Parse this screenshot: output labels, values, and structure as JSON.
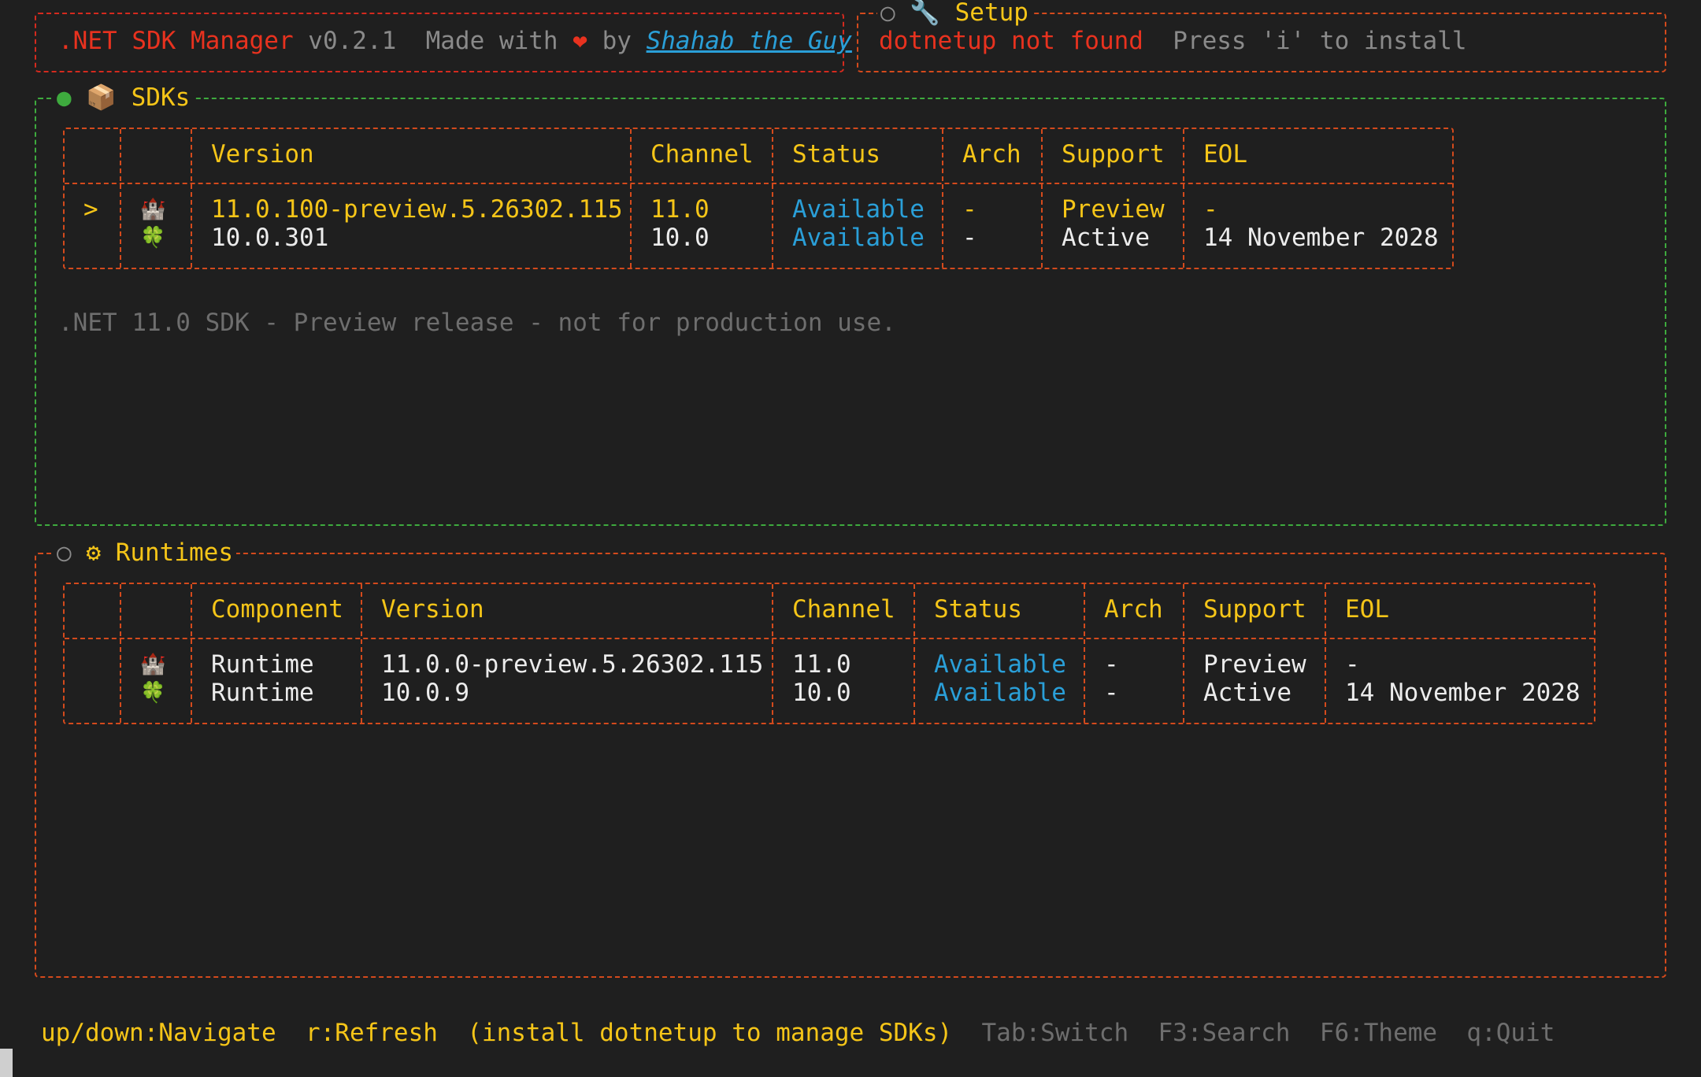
{
  "header": {
    "app_name": ".NET SDK Manager",
    "version": "v0.2.1",
    "made_with": "Made with",
    "by": "by",
    "author": "Shahab the Guy"
  },
  "setup": {
    "title": "Setup",
    "status": "dotnetup not found",
    "hint": "Press 'i' to install"
  },
  "sdks": {
    "title": "SDKs",
    "columns": [
      "Version",
      "Channel",
      "Status",
      "Arch",
      "Support",
      "EOL"
    ],
    "rows": [
      {
        "selector": ">",
        "icon": "castle-icon",
        "version": "11.0.100-preview.5.26302.115",
        "channel": "11.0",
        "status": "Available",
        "arch": "-",
        "support": "Preview",
        "eol": "-"
      },
      {
        "selector": "",
        "icon": "clover-icon",
        "version": "10.0.301",
        "channel": "10.0",
        "status": "Available",
        "arch": "-",
        "support": "Active",
        "eol": "14 November 2028"
      }
    ],
    "description": ".NET 11.0 SDK - Preview release - not for production use."
  },
  "runtimes": {
    "title": "Runtimes",
    "columns": [
      "Component",
      "Version",
      "Channel",
      "Status",
      "Arch",
      "Support",
      "EOL"
    ],
    "rows": [
      {
        "icon": "castle-icon",
        "component": "Runtime",
        "version": "11.0.0-preview.5.26302.115",
        "channel": "11.0",
        "status": "Available",
        "arch": "-",
        "support": "Preview",
        "eol": "-"
      },
      {
        "icon": "clover-icon",
        "component": "Runtime",
        "version": "10.0.9",
        "channel": "10.0",
        "status": "Available",
        "arch": "-",
        "support": "Active",
        "eol": "14 November 2028"
      }
    ]
  },
  "footer": {
    "navigate": "up/down:Navigate",
    "refresh": "r:Refresh",
    "install_hint": "(install dotnetup to manage SDKs)",
    "switch": "Tab:Switch",
    "search": "F3:Search",
    "theme": "F6:Theme",
    "quit": "q:Quit"
  },
  "colors": {
    "background": "#1f1f1f",
    "accent_yellow": "#f5c518",
    "border_orange": "#d44a1c",
    "border_green": "#3eaa3e",
    "status_blue": "#2a9fd8",
    "error_red": "#e8321f"
  }
}
